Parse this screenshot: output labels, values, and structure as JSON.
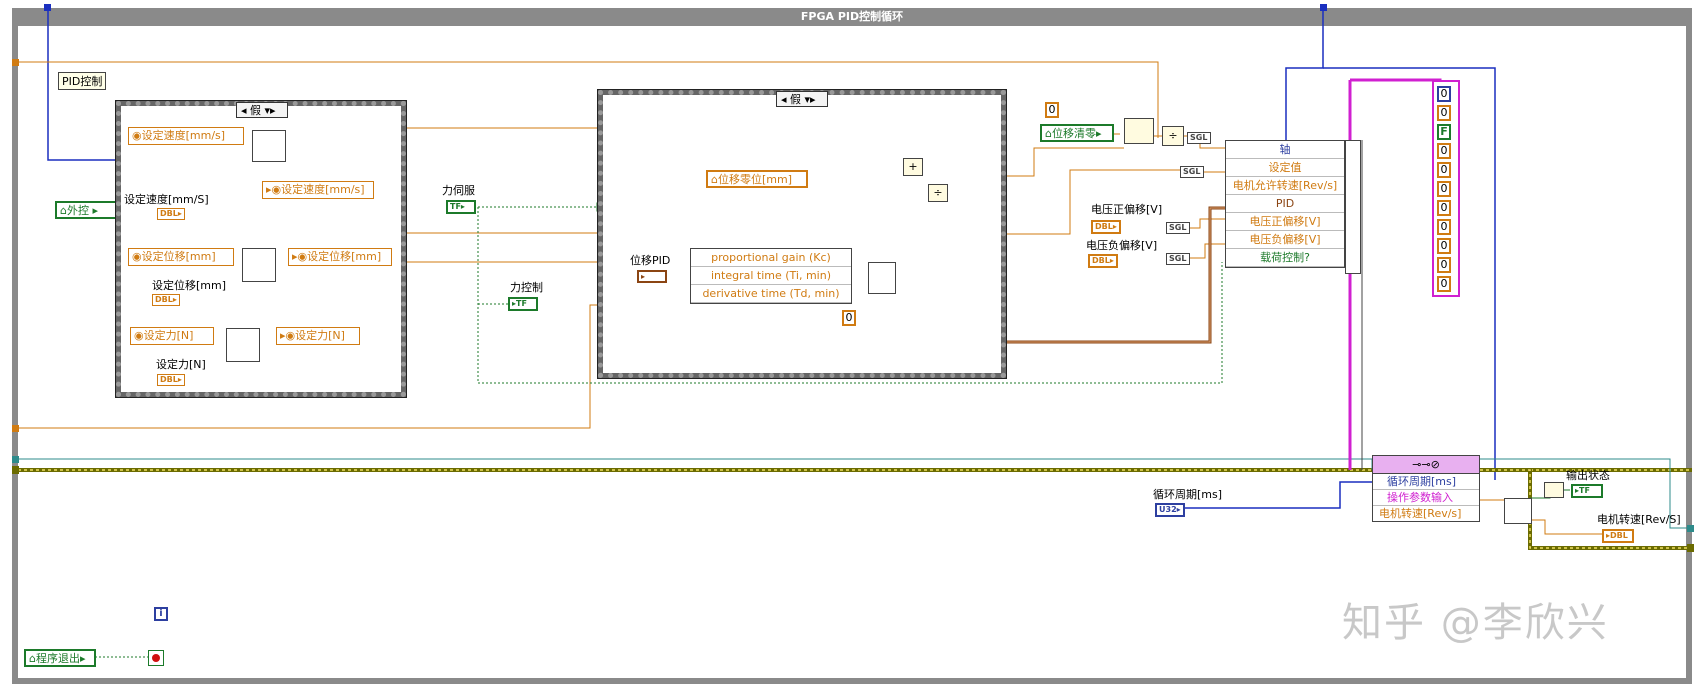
{
  "loop": {
    "title": "FPGA PID控制循环"
  },
  "labels": {
    "pid_control": "PID控制",
    "set_speed": "设定速度[mm/S]",
    "set_position": "设定位移[mm]",
    "set_force": "设定力[N]",
    "force_servo": "力伺服",
    "force_control": "力控制",
    "position_pid": "位移PID",
    "voltage_pos": "电压正偏移[V]",
    "voltage_neg": "电压负偏移[V]",
    "loop_period": "循环周期[ms]",
    "output_state": "输出状态",
    "motor_speed": "电机转速[Rev/S]"
  },
  "case1": {
    "selector": "假"
  },
  "case2": {
    "selector": "假"
  },
  "controls": {
    "external": "外控",
    "speed_in": "设定速度[mm/s]",
    "speed_out": "设定速度[mm/s]",
    "pos_in": "设定位移[mm]",
    "pos_out": "设定位移[mm]",
    "force_in": "设定力[N]",
    "force_out": "设定力[N]",
    "pos_zero": "位移零位[mm]",
    "pos_clear": "位移清零",
    "exit": "程序退出"
  },
  "terminals": {
    "dbl": "DBL",
    "tf": "TF",
    "sgl": "SGL",
    "u32": "U32",
    "i": "i",
    "zero": "0",
    "f": "F"
  },
  "pid_cluster": [
    "proportional gain (Kc)",
    "integral time (Ti, min)",
    "derivative time (Td, min)"
  ],
  "bundle": [
    "轴",
    "设定值",
    "电机允许转速[Rev/s]",
    "PID",
    "电压正偏移[V]",
    "电压负偏移[V]",
    "载荷控制?"
  ],
  "invoke": {
    "header": "⊸⊸⊘",
    "rows": [
      "循环周期[ms]",
      "操作参数输入",
      "电机转速[Rev/s]"
    ]
  },
  "array_values": [
    "0",
    "0",
    "F",
    "0",
    "0",
    "0",
    "0",
    "0",
    "0",
    "0",
    "0"
  ],
  "watermark": "知乎 @李欣兴"
}
